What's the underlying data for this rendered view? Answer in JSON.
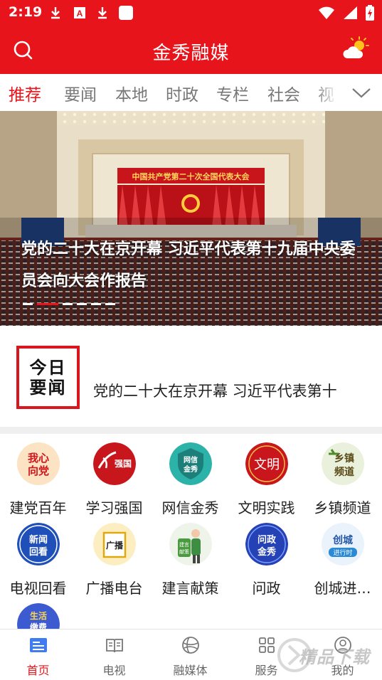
{
  "status_bar": {
    "time": "2:19",
    "icons": [
      "download-icon",
      "a-box-icon",
      "download-icon",
      "blank-square-icon",
      "wifi-icon",
      "signal-icon",
      "battery-icon"
    ]
  },
  "app": {
    "title": "金秀融媒",
    "brand_color": "#e8141b",
    "left_icon": "search-icon",
    "right_icon": "weather-icon"
  },
  "tabs": {
    "items": [
      "推荐",
      "要闻",
      "本地",
      "时政",
      "专栏",
      "社会",
      "视"
    ],
    "active": "推荐",
    "more_icon": "chevron-down-icon"
  },
  "banner": {
    "hall_sign": "中国共产党第二十次全国代表大会",
    "caption": "党的二十大在京开幕 习近平代表第十九届中央委员会向大会作报告",
    "slide_count": 7,
    "active_slide": 2
  },
  "headline": {
    "logo_line1": "今日",
    "logo_line2": "要闻",
    "text": "党的二十大在京开幕 习近平代表第十"
  },
  "grid": [
    {
      "label": "建党百年",
      "icon": "party-heart-icon",
      "icon_text": "我心向党"
    },
    {
      "label": "学习强国",
      "icon": "xuexi-icon",
      "icon_text": "强国"
    },
    {
      "label": "网信金秀",
      "icon": "wangxin-icon",
      "icon_text": "网信金秀"
    },
    {
      "label": "文明实践",
      "icon": "wenming-icon",
      "icon_text": "文明"
    },
    {
      "label": "乡镇频道",
      "icon": "township-icon",
      "icon_text": "乡镇频道"
    },
    {
      "label": "电视回看",
      "icon": "tv-replay-icon",
      "icon_text": "新闻回看"
    },
    {
      "label": "广播电台",
      "icon": "radio-icon",
      "icon_text": "广播"
    },
    {
      "label": "建言献策",
      "icon": "advice-icon",
      "icon_text": "建言献策"
    },
    {
      "label": "问政",
      "icon": "wenzheng-icon",
      "icon_text": "问政金秀"
    },
    {
      "label": "创城进…",
      "icon": "civilized-city-icon",
      "icon_text": "创城进行时"
    },
    {
      "label": "",
      "icon": "life-service-icon",
      "icon_text": "生活缴费"
    }
  ],
  "bottom_nav": [
    {
      "label": "首页",
      "icon": "home-icon",
      "active": true
    },
    {
      "label": "电视",
      "icon": "tv-book-icon",
      "active": false
    },
    {
      "label": "融媒体",
      "icon": "globe-icon",
      "active": false
    },
    {
      "label": "服务",
      "icon": "grid-services-icon",
      "active": false
    },
    {
      "label": "我的",
      "icon": "profile-icon",
      "active": false
    }
  ],
  "watermark": "精品下载"
}
